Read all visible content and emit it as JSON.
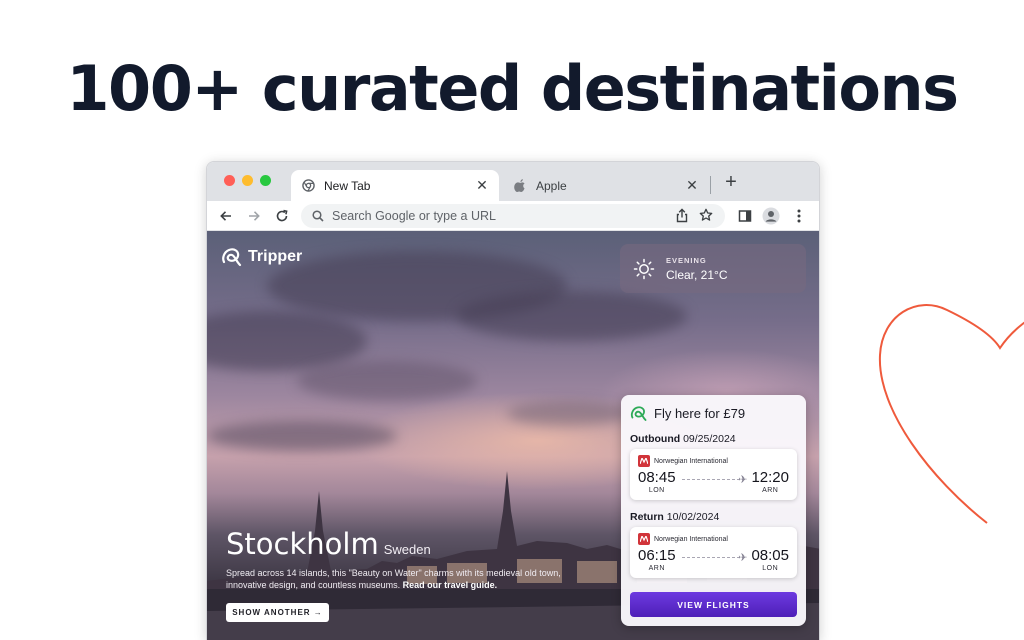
{
  "headline": "100+ curated destinations",
  "browser": {
    "tabs": [
      {
        "label": "New Tab",
        "icon": "chrome-icon",
        "active": true
      },
      {
        "label": "Apple",
        "icon": "apple-icon",
        "active": false
      }
    ],
    "new_tab_label": "+",
    "omnibox_placeholder": "Search Google or type a URL"
  },
  "app": {
    "brand": "Tripper",
    "weather": {
      "label": "EVENING",
      "value": "Clear, 21°C",
      "icon": "sun-icon"
    },
    "destination": {
      "city": "Stockholm",
      "country": "Sweden",
      "description": "Spread across 14 islands, this \"Beauty on Water\" charms with its medieval old town, innovative design, and countless museums.",
      "guide_link": "Read our travel guide."
    },
    "show_another": "SHOW ANOTHER →",
    "flight_card": {
      "title": "Fly here for £79",
      "outbound": {
        "label": "Outbound",
        "date": "09/25/2024",
        "airline": "Norwegian International",
        "depart_time": "08:45",
        "depart_code": "LON",
        "arrive_time": "12:20",
        "arrive_code": "ARN"
      },
      "return": {
        "label": "Return",
        "date": "10/02/2024",
        "airline": "Norwegian International",
        "depart_time": "06:15",
        "depart_code": "ARN",
        "arrive_time": "08:05",
        "arrive_code": "LON"
      },
      "cta": "VIEW FLIGHTS"
    }
  },
  "colors": {
    "headline": "#121a2c",
    "heart": "#ef5a3c",
    "cta": "#5b2bd0",
    "airline_logo": "#d1343a"
  }
}
